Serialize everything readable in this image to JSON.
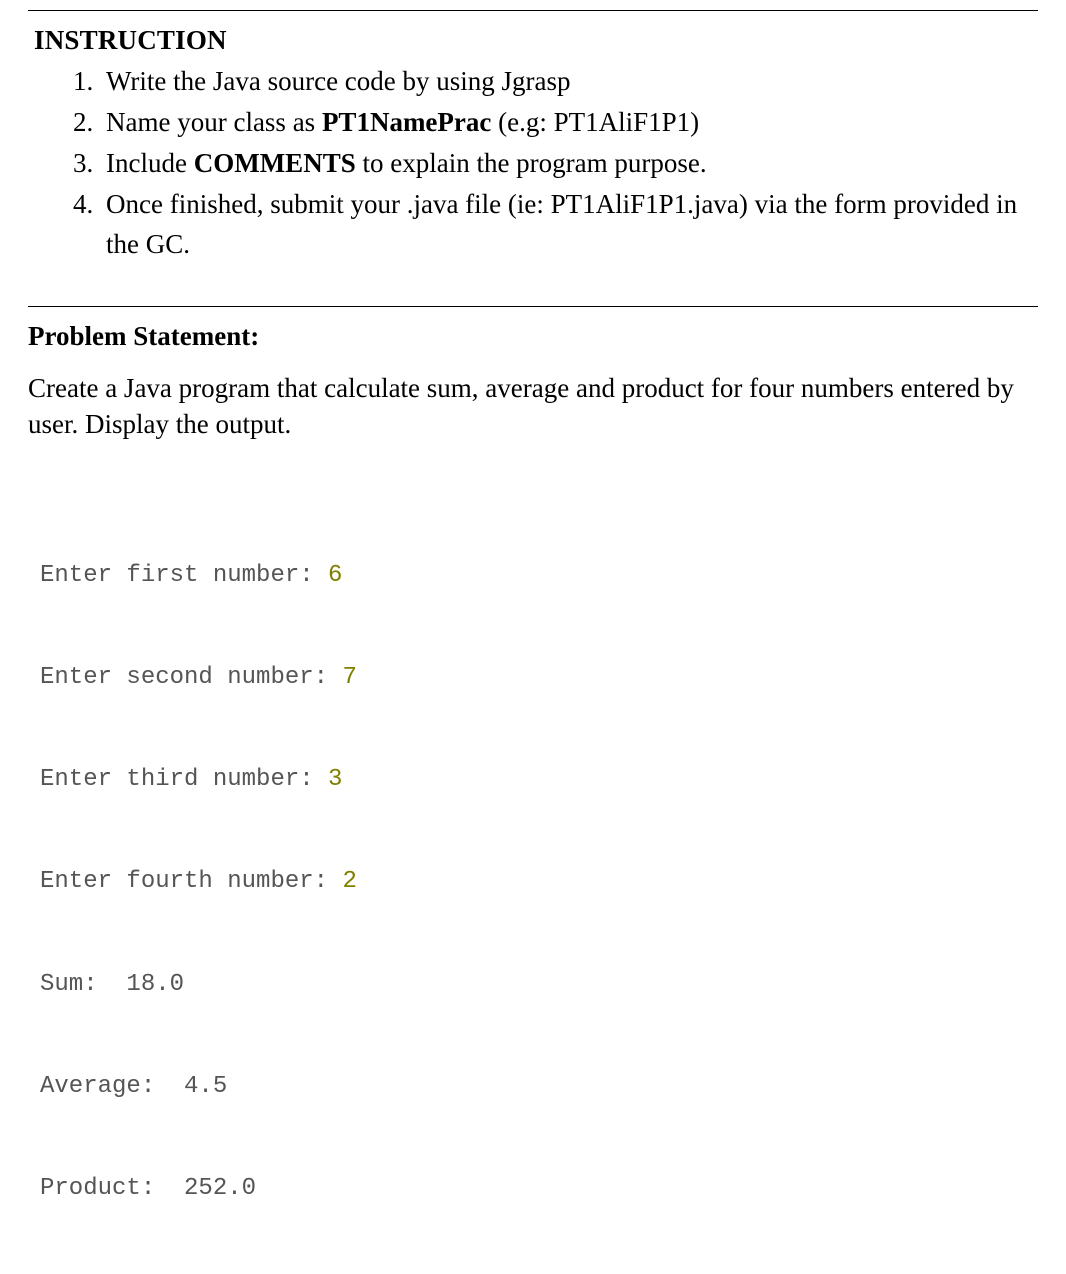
{
  "instruction": {
    "heading": "INSTRUCTION",
    "items": [
      {
        "pre": "Write the Java source code by using Jgrasp",
        "bold": "",
        "post": ""
      },
      {
        "pre": "Name your class as ",
        "bold": "PT1NamePrac",
        "post": " (e.g: PT1AliF1P1)"
      },
      {
        "pre": "Include ",
        "bold": "COMMENTS",
        "post": " to explain the program purpose."
      },
      {
        "pre": "Once finished, submit your .java file (ie: PT1AliF1P1.java) via the form provided in the GC.",
        "bold": "",
        "post": ""
      }
    ]
  },
  "problem": {
    "heading": "Problem Statement:",
    "text": "Create a Java program that calculate sum, average and product for four numbers entered by user. Display the output."
  },
  "console": {
    "lines": [
      {
        "prompt": "Enter first number: ",
        "input": "6"
      },
      {
        "prompt": "Enter second number: ",
        "input": "7"
      },
      {
        "prompt": "Enter third number: ",
        "input": "3"
      },
      {
        "prompt": "Enter fourth number: ",
        "input": "2"
      },
      {
        "prompt": "Sum:  18.0",
        "input": ""
      },
      {
        "prompt": "Average:  4.5",
        "input": ""
      },
      {
        "prompt": "Product:  252.0",
        "input": ""
      }
    ]
  }
}
